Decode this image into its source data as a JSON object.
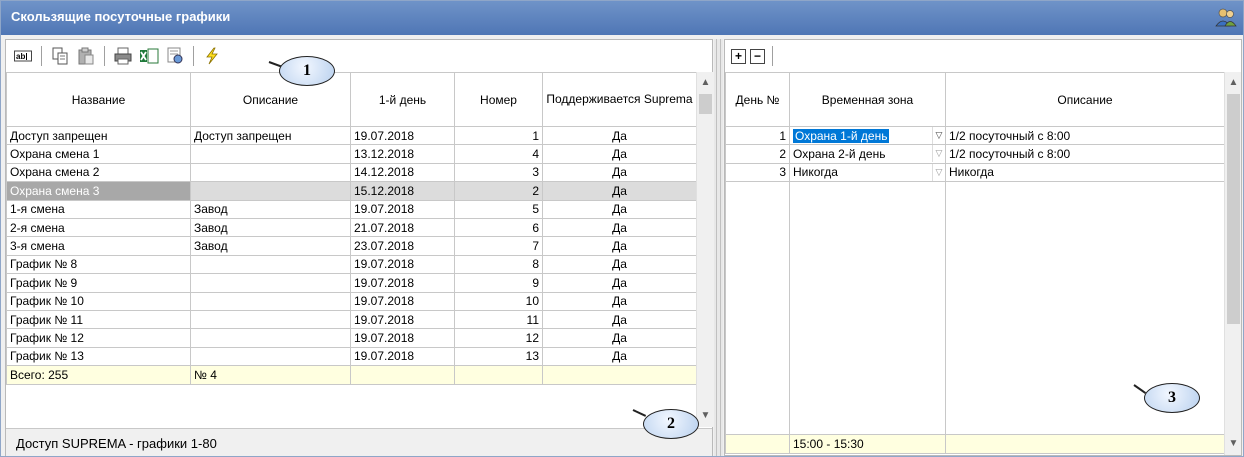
{
  "window": {
    "title": "Скользящие посуточные графики"
  },
  "left": {
    "columns": [
      "Название",
      "Описание",
      "1-й день",
      "Номер",
      "Поддерживается Suprema"
    ],
    "rows": [
      [
        "Доступ запрещен",
        "Доступ запрещен",
        "19.07.2018",
        "1",
        "Да"
      ],
      [
        "Охрана смена 1",
        "",
        "13.12.2018",
        "4",
        "Да"
      ],
      [
        "Охрана смена 2",
        "",
        "14.12.2018",
        "3",
        "Да"
      ],
      [
        "Охрана смена 3",
        "",
        "15.12.2018",
        "2",
        "Да"
      ],
      [
        "1-я смена",
        "Завод",
        "19.07.2018",
        "5",
        "Да"
      ],
      [
        "2-я смена",
        "Завод",
        "21.07.2018",
        "6",
        "Да"
      ],
      [
        "3-я смена",
        "Завод",
        "23.07.2018",
        "7",
        "Да"
      ],
      [
        "График  №   8",
        "",
        "19.07.2018",
        "8",
        "Да"
      ],
      [
        "График  №   9",
        "",
        "19.07.2018",
        "9",
        "Да"
      ],
      [
        "График  №  10",
        "",
        "19.07.2018",
        "10",
        "Да"
      ],
      [
        "График  №  11",
        "",
        "19.07.2018",
        "11",
        "Да"
      ],
      [
        "График  №  12",
        "",
        "19.07.2018",
        "12",
        "Да"
      ],
      [
        "График  №  13",
        "",
        "19.07.2018",
        "13",
        "Да"
      ]
    ],
    "selected_row": 3,
    "footer": [
      "Всего: 255",
      "№ 4",
      "",
      "",
      ""
    ],
    "status": "Доступ SUPREMA - графики 1-80"
  },
  "right": {
    "columns": [
      "День №",
      "Временная зона",
      "Описание"
    ],
    "rows": [
      [
        "1",
        "Охрана 1-й день",
        "1/2 посуточный с 8:00"
      ],
      [
        "2",
        "Охрана 2-й день",
        "1/2 посуточный с 8:00"
      ],
      [
        "3",
        "Никогда",
        "Никогда"
      ]
    ],
    "footer": [
      "",
      "15:00 - 15:30",
      ""
    ]
  },
  "callouts": [
    "1",
    "2",
    "3"
  ],
  "colors": {
    "title_bar": "#5b80bc",
    "selection": "#0078d7",
    "footer_bg": "#ffffe0"
  },
  "icons": [
    "rename-icon",
    "copy-icon",
    "paste-icon",
    "print-icon",
    "excel-icon",
    "export-icon",
    "lightning-icon",
    "add-row-icon",
    "remove-row-icon",
    "users-icon"
  ]
}
